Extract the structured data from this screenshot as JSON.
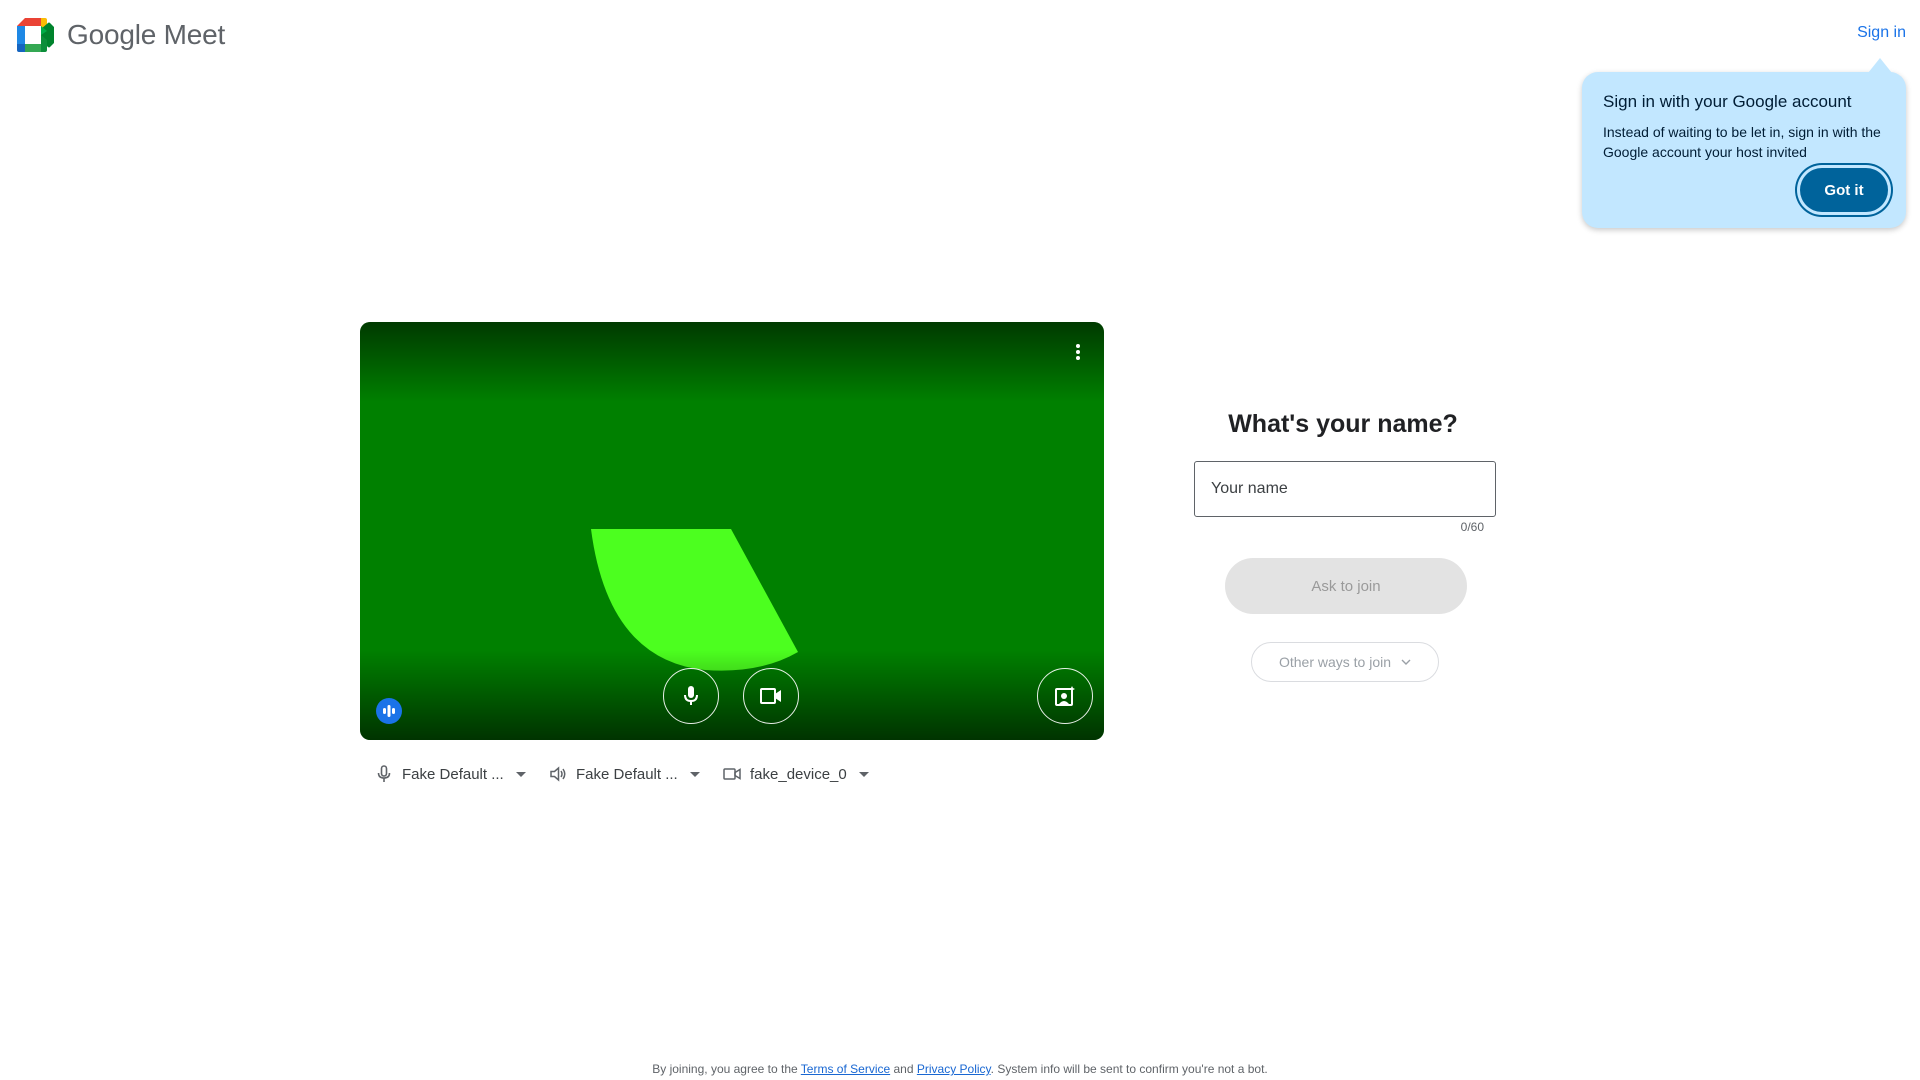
{
  "header": {
    "app_name": "Google Meet",
    "sign_in": "Sign in"
  },
  "signin_tip": {
    "title": "Sign in with your Google account",
    "body": "Instead of waiting to be let in, sign in with the Google account your host invited",
    "button": "Got it"
  },
  "preview": {
    "background_color": "#008000",
    "shape_color": "#4cff1f",
    "icons": [
      "more-vert-icon",
      "audio-level-icon",
      "microphone-icon",
      "camera-icon",
      "visual-effects-icon"
    ]
  },
  "devices": {
    "microphone": "Fake Default ...",
    "speaker": "Fake Default ...",
    "camera": "fake_device_0"
  },
  "join": {
    "title": "What's your name?",
    "name_placeholder": "Your name",
    "name_value": "",
    "char_count": "0/60",
    "ask_to_join": "Ask to join",
    "other_ways": "Other ways to join"
  },
  "footer": {
    "prefix": "By joining, you agree to the ",
    "terms": "Terms of Service",
    "and": " and ",
    "privacy": "Privacy Policy",
    "suffix": ". System info will be sent to confirm you're not a bot."
  },
  "colors": {
    "accent": "#1a73e8",
    "tip_background": "#c2e7ff",
    "tip_button": "#00639b"
  }
}
